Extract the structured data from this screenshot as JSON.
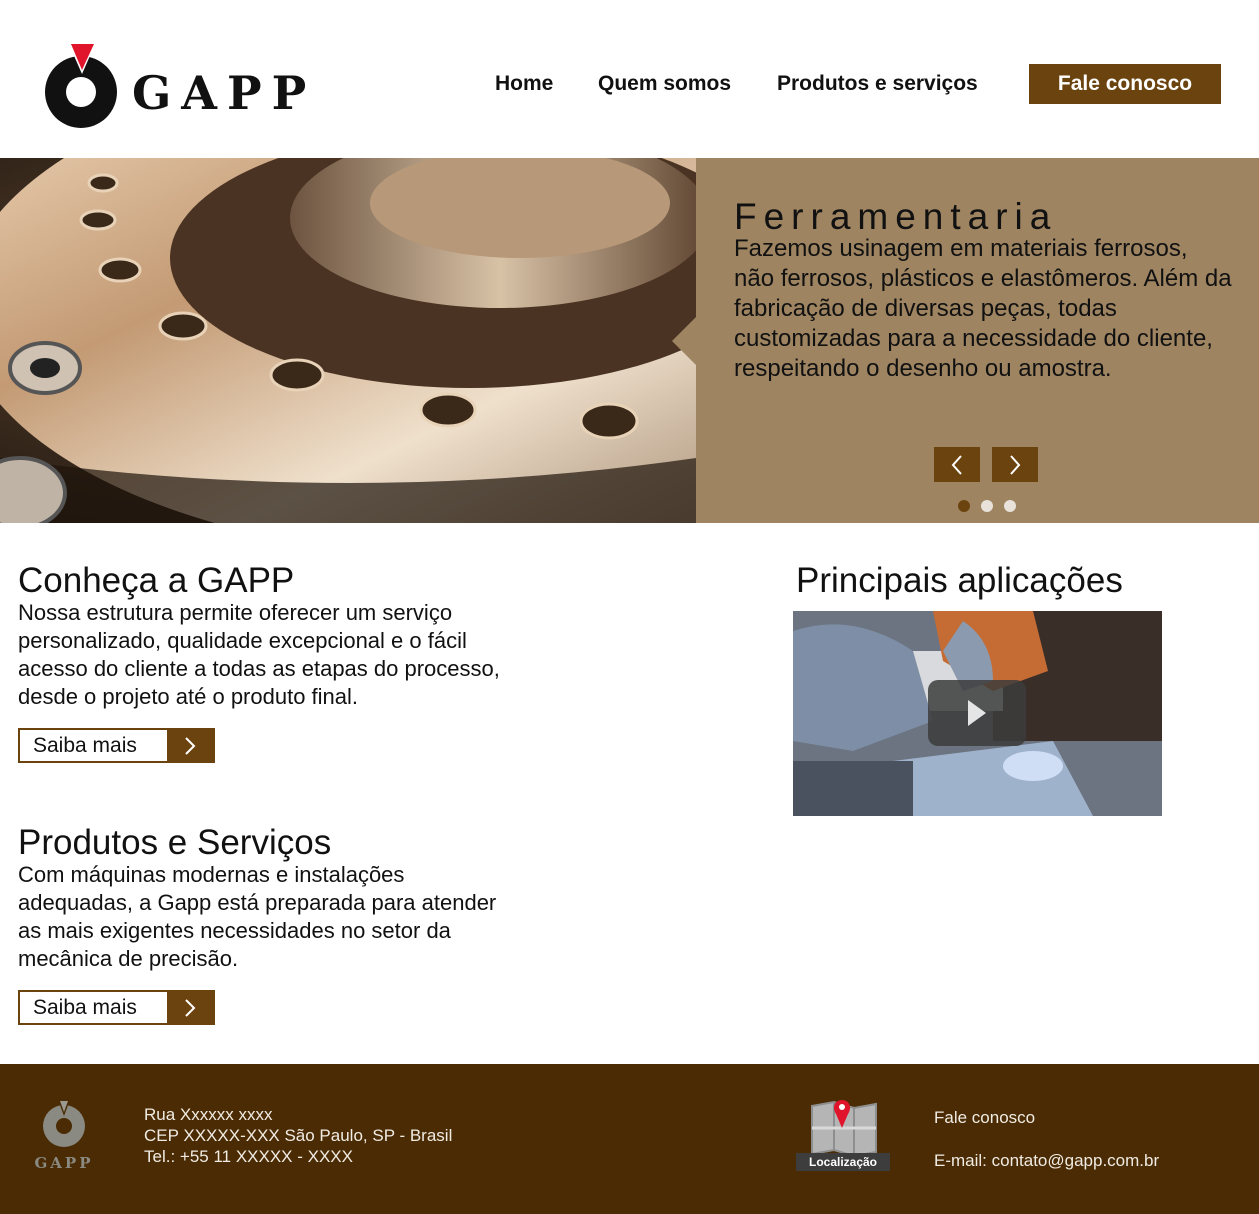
{
  "brand": {
    "name": "GAPP",
    "accent": "#6b430f",
    "panel": "#9e8461",
    "footer_bg": "#4a2b03"
  },
  "nav": {
    "items": [
      "Home",
      "Quem somos",
      "Produtos e serviços"
    ],
    "cta": "Fale conosco"
  },
  "hero": {
    "title": "Ferramentaria",
    "text": "Fazemos usinagem em materiais ferrosos, não ferrosos, plásticos e elastômeros. Além da fabricação de diversas peças, todas customizadas para a necessidade do cliente, respeitando o desenho ou amostra.",
    "prev_icon": "chevron-left-icon",
    "next_icon": "chevron-right-icon",
    "slides": 3,
    "active_slide": 1
  },
  "about": {
    "title": "Conheça a GAPP",
    "text": "Nossa estrutura permite oferecer um serviço personalizado, qualidade excepcional e o fácil acesso do cliente a todas as etapas do processo, desde o projeto até o produto final.",
    "button": "Saiba mais"
  },
  "products": {
    "title": "Produtos e Serviços",
    "text": "Com máquinas modernas e instalações adequadas, a Gapp está preparada para atender as mais exigentes necessidades no setor da mecânica de precisão.",
    "button": "Saiba mais"
  },
  "applications": {
    "title": "Principais aplicações",
    "video_icon": "play-icon"
  },
  "footer": {
    "address_line1": "Rua Xxxxxx xxxx",
    "address_line2": "CEP XXXXX-XXX São Paulo, SP - Brasil",
    "address_line3": "Tel.: +55 11 XXXXX - XXXX",
    "map_label": "Localização",
    "contact": "Fale conosco",
    "email": "E-mail: contato@gapp.com.br",
    "logo_text": "GAPP"
  }
}
